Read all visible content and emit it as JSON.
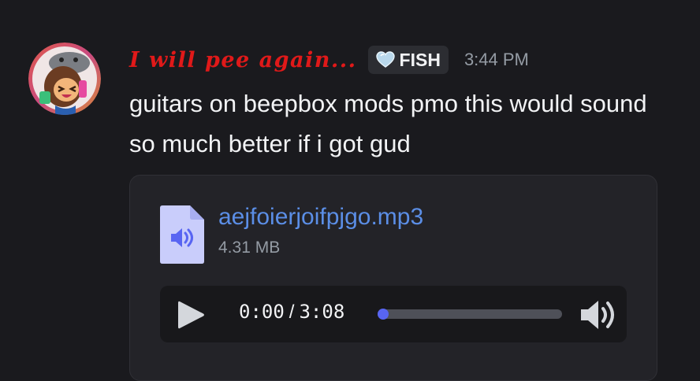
{
  "message": {
    "username": "I will pee again...",
    "username_color": "#e01919",
    "tag": {
      "icon": "heart-icon",
      "label": "FISH"
    },
    "timestamp": "3:44 PM",
    "content": "guitars on beepbox mods pmo this would sound so much better if i got gud",
    "avatar": {
      "icon": "avatar-icon"
    }
  },
  "attachment": {
    "file_icon": "audio-file-icon",
    "filename": "aejfoierjoifpjgo.mp3",
    "size": "4.31 MB",
    "link_color": "#5b8ee6",
    "player": {
      "current_time": "0:00",
      "separator": "/",
      "duration": "3:08",
      "progress_fraction": 0,
      "accent_color": "#5865f2",
      "play_icon": "play-icon",
      "volume_icon": "volume-icon"
    }
  }
}
